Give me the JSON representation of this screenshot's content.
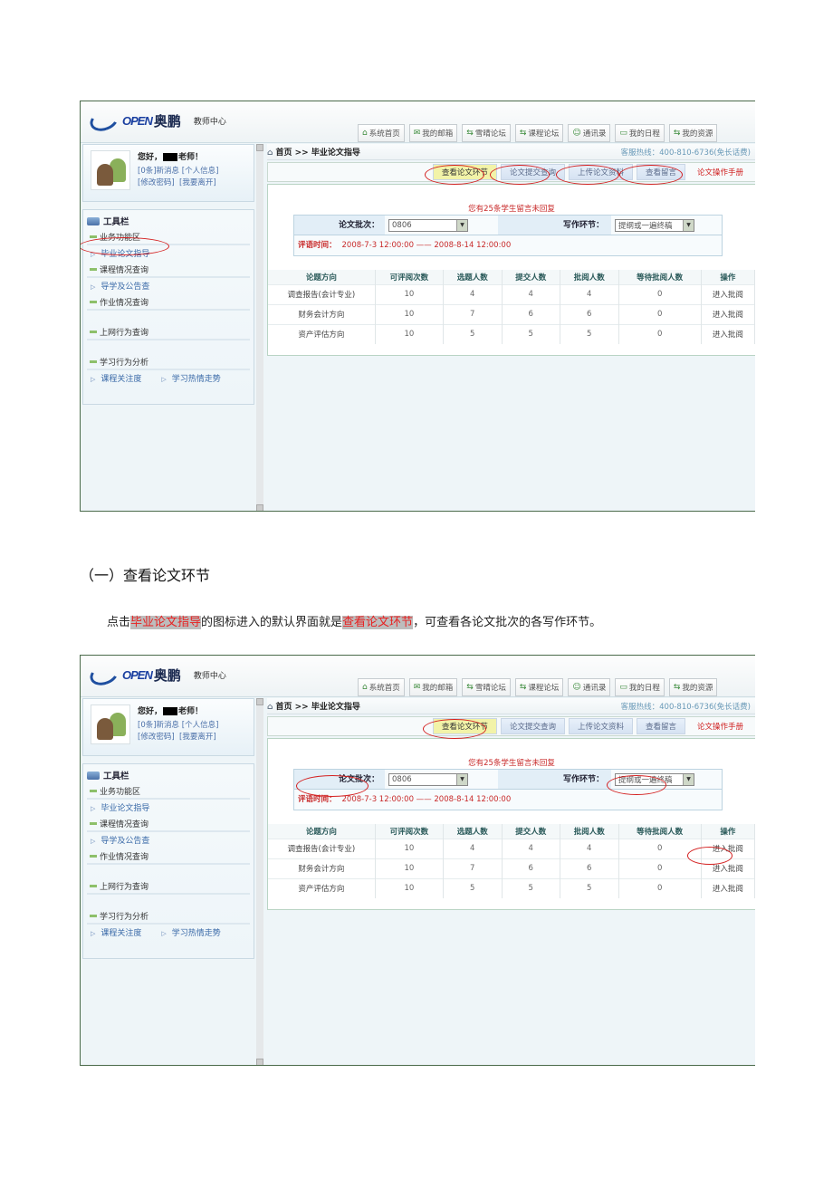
{
  "app": {
    "logo_text": "OPEN",
    "logo_cn": "奥鹏",
    "logo_sub": "教师中心"
  },
  "nav_tabs": [
    {
      "icon": "home-icon",
      "glyph": "⌂",
      "label": "系统首页"
    },
    {
      "icon": "mail-icon",
      "glyph": "✉",
      "label": "我的邮箱"
    },
    {
      "icon": "forum-icon",
      "glyph": "⇆",
      "label": "雪晴论坛"
    },
    {
      "icon": "forum-icon",
      "glyph": "⇆",
      "label": "课程论坛"
    },
    {
      "icon": "contacts-icon",
      "glyph": "☺",
      "label": "通讯录"
    },
    {
      "icon": "calendar-icon",
      "glyph": "▭",
      "label": "我的日程"
    },
    {
      "icon": "resource-icon",
      "glyph": "⇆",
      "label": "我的资源"
    }
  ],
  "user": {
    "greeting_prefix": "您好，",
    "greeting_suffix": "老师！",
    "messages": "[0条]新消息",
    "profile": "[个人信息]",
    "change_password": "[修改密码]",
    "logout": "[我要离开]"
  },
  "toolbar": {
    "title": "工具栏",
    "sections": [
      {
        "label": "业务功能区",
        "links": [
          "毕业论文指导"
        ]
      },
      {
        "label": "课程情况查询",
        "links": [
          "导学及公告查"
        ]
      },
      {
        "label": "作业情况查询",
        "links": []
      },
      {
        "label": "上网行为查询",
        "links": []
      },
      {
        "label": "学习行为分析",
        "links": [
          "课程关注度",
          "学习热情走势"
        ]
      }
    ]
  },
  "breadcrumb": {
    "home": "首页",
    "sep": ">>",
    "current": "毕业论文指导",
    "hotline": "客服热线：400-810-6736(免长话费)"
  },
  "sub_tabs": [
    {
      "label": "查看论文环节",
      "active": true
    },
    {
      "label": "论文提交查询",
      "active": false
    },
    {
      "label": "上传论文资料",
      "active": false
    },
    {
      "label": "查看留言",
      "active": false
    },
    {
      "label": "论文操作手册",
      "active": false
    }
  ],
  "notice": "您有25条学生留言未回复",
  "form": {
    "batch_label": "论文批次：",
    "batch_value": "0806",
    "stage_label": "写作环节：",
    "stage_value": "提纲或一遍终稿",
    "review_label": "评语时间：",
    "review_time": "2008-7-3 12:00:00 —— 2008-8-14 12:00:00"
  },
  "table": {
    "headers": [
      "论题方向",
      "可评阅次数",
      "选题人数",
      "提交人数",
      "批阅人数",
      "等待批阅人数",
      "操作"
    ],
    "rows": [
      [
        "调查报告(会计专业)",
        "10",
        "4",
        "4",
        "4",
        "0",
        "进入批阅"
      ],
      [
        "财务会计方向",
        "10",
        "7",
        "6",
        "6",
        "0",
        "进入批阅"
      ],
      [
        "资产评估方向",
        "10",
        "5",
        "5",
        "5",
        "0",
        "进入批阅"
      ]
    ]
  },
  "doc": {
    "heading": "（一）查看论文环节",
    "para_1": "点击",
    "para_hl_1": "毕业论文指导",
    "para_2": "的图标进入的默认界面就是",
    "para_hl_2": "查看论文环节",
    "para_3": "，可查看各论文批次的各写作环节。"
  },
  "colors": {
    "annotation_red": "#d42020",
    "active_tab": "#f2f3a8",
    "notice_red": "#c82a2a"
  }
}
